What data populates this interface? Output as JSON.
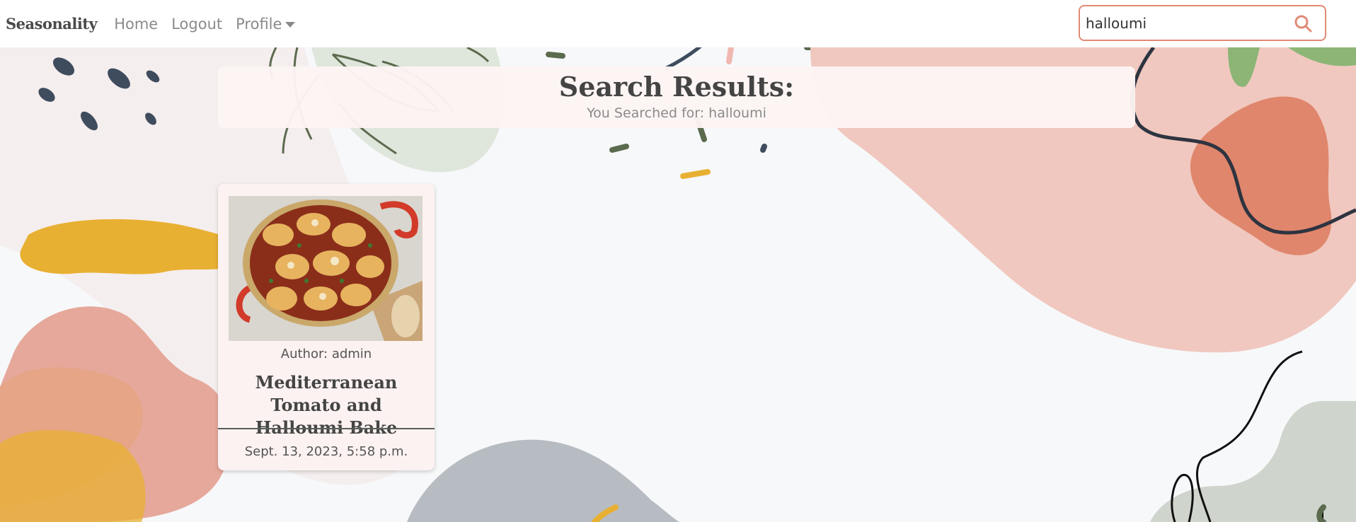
{
  "nav": {
    "brand": "Seasonality",
    "home": "Home",
    "logout": "Logout",
    "profile": "Profile"
  },
  "search": {
    "value": "halloumi",
    "placeholder": "",
    "icon": "search-icon"
  },
  "results": {
    "title": "Search Results:",
    "subtitle": "You Searched for: halloumi"
  },
  "cards": [
    {
      "author": "Author: admin",
      "title": "Mediterranean Tomato and Halloumi Bake",
      "date": "Sept. 13, 2023, 5:58 p.m."
    }
  ],
  "colors": {
    "accent": "#e08a75",
    "navy": "#3e4c5e",
    "mustard": "#e8b032",
    "sage": "#5b6b4e",
    "blush": "#f0c8bf",
    "terracotta": "#e0866c"
  }
}
